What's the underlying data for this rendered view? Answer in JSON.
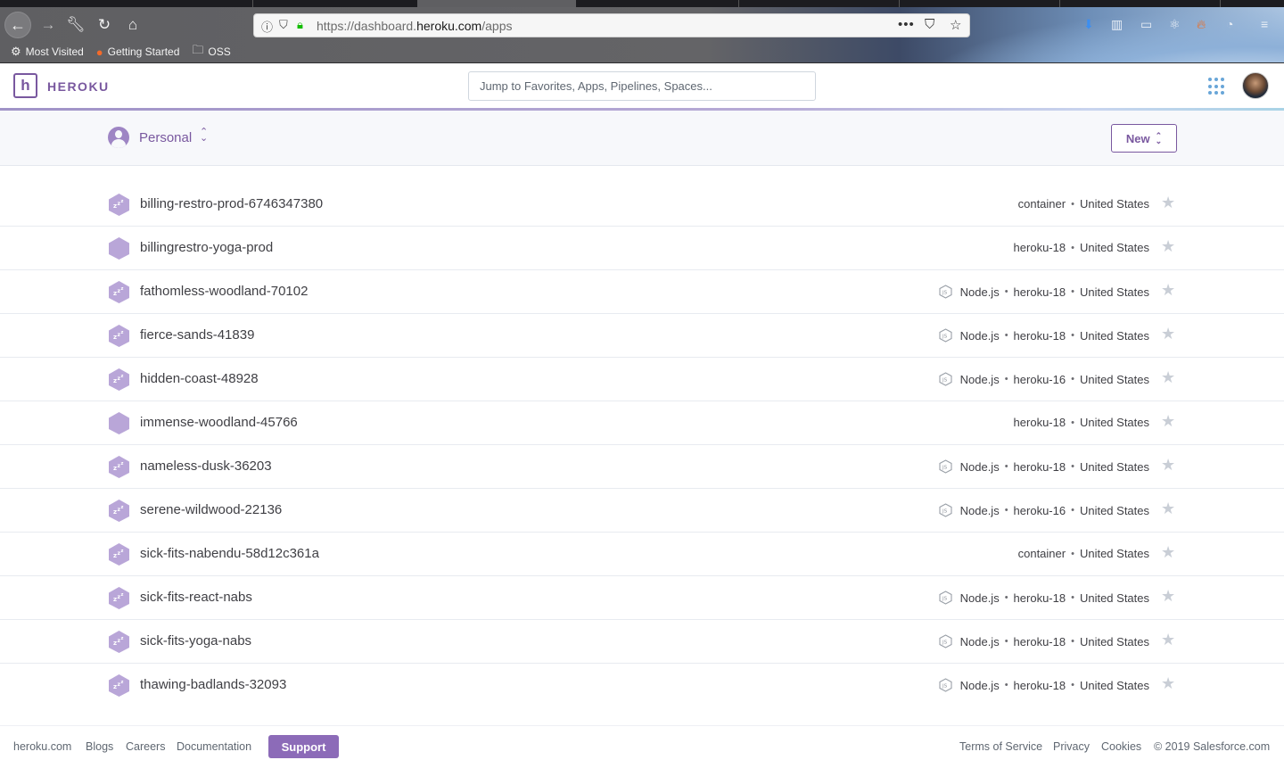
{
  "browser": {
    "url_prefix": "https://dashboard.",
    "url_domain": "heroku.com",
    "url_path": "/apps",
    "bookmarks": [
      {
        "label": "Most Visited",
        "icon": "gear-icon"
      },
      {
        "label": "Getting Started",
        "icon": "firefox-icon"
      },
      {
        "label": "OSS",
        "icon": "folder-icon"
      }
    ]
  },
  "header": {
    "brand": "HEROKU",
    "logo_letter": "h",
    "search_placeholder": "Jump to Favorites, Apps, Pipelines, Spaces..."
  },
  "context": {
    "account": "Personal",
    "new_label": "New"
  },
  "apps": [
    {
      "name": "billing-restro-prod-6746347380",
      "sleeping": true,
      "language": "",
      "stack": "container",
      "region": "United States"
    },
    {
      "name": "billingrestro-yoga-prod",
      "sleeping": false,
      "language": "",
      "stack": "heroku-18",
      "region": "United States"
    },
    {
      "name": "fathomless-woodland-70102",
      "sleeping": true,
      "language": "Node.js",
      "stack": "heroku-18",
      "region": "United States"
    },
    {
      "name": "fierce-sands-41839",
      "sleeping": true,
      "language": "Node.js",
      "stack": "heroku-18",
      "region": "United States"
    },
    {
      "name": "hidden-coast-48928",
      "sleeping": true,
      "language": "Node.js",
      "stack": "heroku-16",
      "region": "United States"
    },
    {
      "name": "immense-woodland-45766",
      "sleeping": false,
      "language": "",
      "stack": "heroku-18",
      "region": "United States"
    },
    {
      "name": "nameless-dusk-36203",
      "sleeping": true,
      "language": "Node.js",
      "stack": "heroku-18",
      "region": "United States"
    },
    {
      "name": "serene-wildwood-22136",
      "sleeping": true,
      "language": "Node.js",
      "stack": "heroku-16",
      "region": "United States"
    },
    {
      "name": "sick-fits-nabendu-58d12c361a",
      "sleeping": true,
      "language": "",
      "stack": "container",
      "region": "United States"
    },
    {
      "name": "sick-fits-react-nabs",
      "sleeping": true,
      "language": "Node.js",
      "stack": "heroku-18",
      "region": "United States"
    },
    {
      "name": "sick-fits-yoga-nabs",
      "sleeping": true,
      "language": "Node.js",
      "stack": "heroku-18",
      "region": "United States"
    },
    {
      "name": "thawing-badlands-32093",
      "sleeping": true,
      "language": "Node.js",
      "stack": "heroku-18",
      "region": "United States"
    }
  ],
  "footer": {
    "links": [
      "heroku.com",
      "Blogs",
      "Careers",
      "Documentation"
    ],
    "support": "Support",
    "right_links": [
      "Terms of Service",
      "Privacy",
      "Cookies"
    ],
    "copyright": "© 2019 Salesforce.com"
  },
  "colors": {
    "brand_purple": "#79589f",
    "hex_fill": "#b9a6d8",
    "support_bg": "#8c6bb8"
  }
}
